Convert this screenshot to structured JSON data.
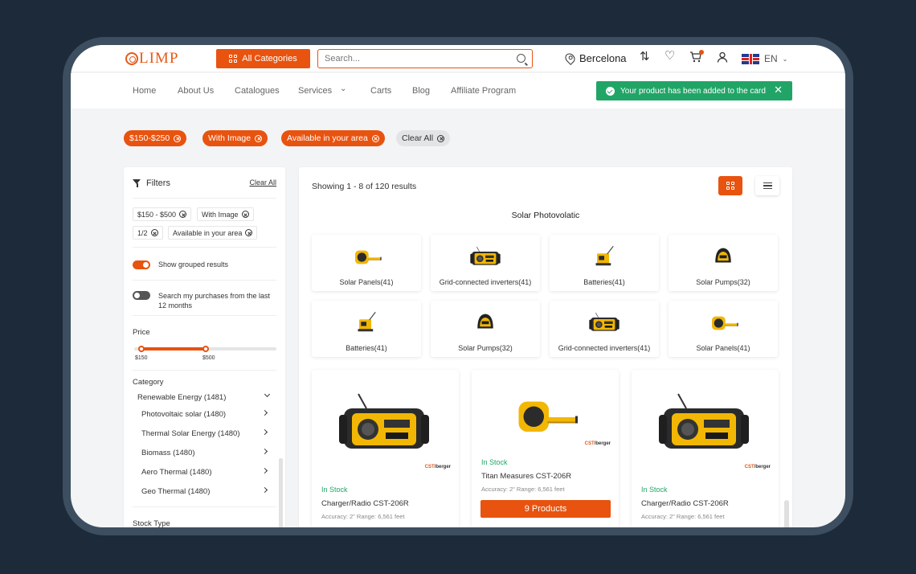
{
  "header": {
    "logo": "LIMP",
    "all_categories": "All Categories",
    "search_placeholder": "Search...",
    "location": "Bercelona",
    "language": "EN"
  },
  "nav": {
    "items": [
      "Home",
      "About Us",
      "Catalogues",
      "Services",
      "Carts",
      "Blog",
      "Affiliate Program"
    ]
  },
  "toast": {
    "message": "Your product has been added to the card"
  },
  "active_filters": [
    "$150-$250",
    "With Image",
    "Available in your area",
    "Clear All"
  ],
  "sidebar": {
    "title": "Filters",
    "clear_all": "Clear All",
    "tags": [
      "$150 - $500",
      "With Image",
      "1/2",
      "Available in your area"
    ],
    "show_grouped": "Show grouped results",
    "search_purchases": "Search my purchases from the last 12 months",
    "price_label": "Price",
    "price_min": "$150",
    "price_max": "$500",
    "price_range_fraction": [
      0.05,
      0.5
    ],
    "category_label": "Category",
    "category_parent": "Renewable Energy (1481)",
    "categories": [
      "Photovoltaic solar (1480)",
      "Thermal Solar Energy (1480)",
      "Biomass (1480)",
      "Aero Thermal (1480)",
      "Geo Thermal (1480)"
    ],
    "stock_type": "Stock Type"
  },
  "main": {
    "showing": "Showing 1 - 8 of 120 results",
    "section_title": "Solar Photovolatic",
    "tiles": [
      {
        "label": "Solar Panels(41)",
        "icon": "tape-measure-icon"
      },
      {
        "label": "Grid-connected inverters(41)",
        "icon": "radio-icon"
      },
      {
        "label": "Batteries(41)",
        "icon": "compactor-icon"
      },
      {
        "label": "Solar Pumps(32)",
        "icon": "helmet-icon"
      },
      {
        "label": "Batteries(41)",
        "icon": "compactor-icon"
      },
      {
        "label": "Solar Pumps(32)",
        "icon": "helmet-icon"
      },
      {
        "label": "Grid-connected inverters(41)",
        "icon": "radio-icon"
      },
      {
        "label": "Solar Panels(41)",
        "icon": "tape-measure-icon"
      }
    ],
    "products": [
      {
        "stock": "In Stock",
        "name": "Charger/Radio CST-206R",
        "meta": "Accuracy: 2\" Range: 6,561 feet",
        "brand": "CST",
        "brand2": "/berger"
      },
      {
        "stock": "In Stock",
        "name": "Titan Measures CST-206R",
        "meta": "Accuracy: 2\" Range: 6,561 feet",
        "brand": "CST",
        "brand2": "/berger",
        "button": "9 Products"
      },
      {
        "stock": "In Stock",
        "name": "Charger/Radio CST-206R",
        "meta": "Accuracy: 2\" Range: 6,561 feet",
        "brand": "CST",
        "brand2": "/berger"
      }
    ]
  },
  "colors": {
    "accent": "#e8530f",
    "success": "#21a566",
    "frame": "#3c4e60",
    "background": "#1c2a3a"
  }
}
